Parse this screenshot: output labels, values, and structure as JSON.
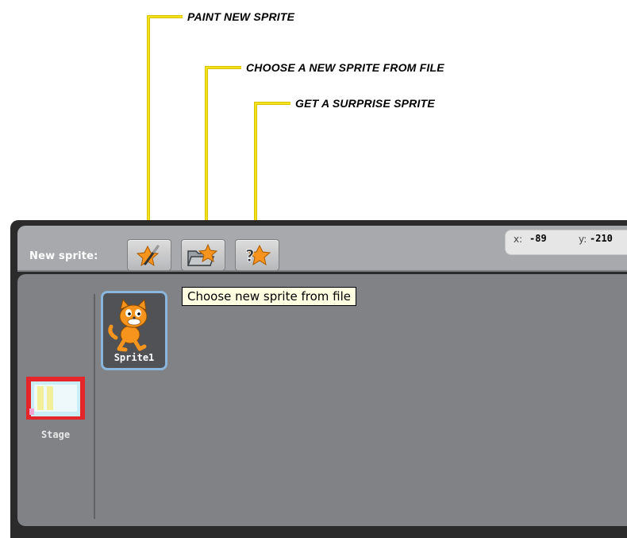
{
  "annotations": {
    "paint": "PAINT NEW SPRITE",
    "choose": "CHOOSE A NEW SPRITE FROM FILE",
    "surprise": "GET A SURPRISE SPRITE"
  },
  "toolbar": {
    "label": "New sprite:",
    "buttons": [
      {
        "icon": "paint-sprite-icon"
      },
      {
        "icon": "folder-star-icon"
      },
      {
        "icon": "question-star-icon"
      }
    ]
  },
  "coords": {
    "x_label": "x:",
    "x_value": "-89",
    "y_label": "y:",
    "y_value": "-210"
  },
  "sprites": [
    {
      "name": "Sprite1",
      "icon": "cat-sprite-icon"
    }
  ],
  "stage": {
    "label": "Stage"
  },
  "tooltip": "Choose new sprite from file",
  "colors": {
    "callout": "#f5e31a",
    "tile_border": "#8ab5dd",
    "panel": "#808285",
    "toolbar": "#a7a9ac"
  }
}
